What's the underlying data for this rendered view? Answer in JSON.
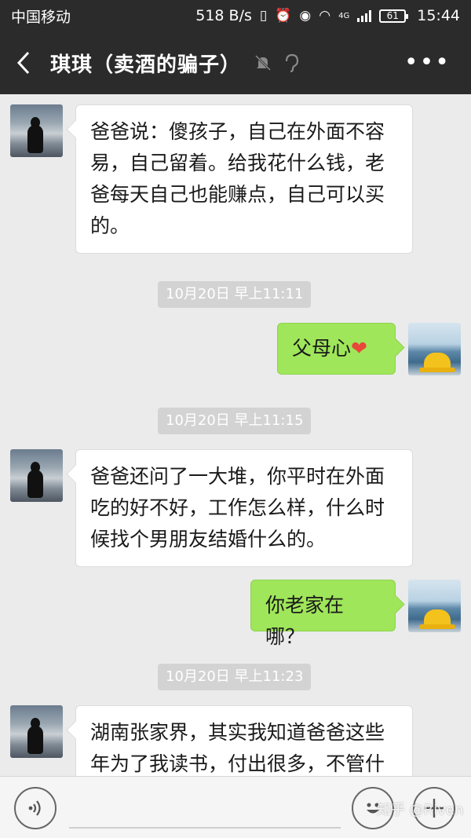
{
  "status_bar": {
    "carrier": "中国移动",
    "speed": "518 B/s",
    "network": "4G",
    "battery": "61",
    "time": "15:44"
  },
  "header": {
    "back_icon": "chevron-left-icon",
    "title": "琪琪（卖酒的骗子）",
    "mute_icon": "bell-muted-icon",
    "earpiece_icon": "ear-icon",
    "more_label": "•••"
  },
  "messages": [
    {
      "side": "left",
      "text": "爸爸说：傻孩子，自己在外面不容易，自己留着。给我花什么钱，老爸每天自己也能赚点，自己可以买的。"
    },
    {
      "type": "time",
      "text": "10月20日 早上11:11"
    },
    {
      "side": "right",
      "text": "父母心",
      "emoji": "❤"
    },
    {
      "type": "time",
      "text": "10月20日 早上11:15"
    },
    {
      "side": "left",
      "text": "爸爸还问了一大堆，你平时在外面吃的好不好，工作怎么样，什么时候找个男朋友结婚什么的。"
    },
    {
      "side": "right",
      "text": "你老家在哪？"
    },
    {
      "type": "time",
      "text": "10月20日 早上11:23"
    },
    {
      "side": "left",
      "text": "湖南张家界，其实我知道爸爸这些年为了我读书，付出很多，不管什"
    }
  ],
  "input_bar": {
    "voice_icon": "voice-icon",
    "emoji_icon": "emoji-icon",
    "plus_icon": "plus-icon"
  },
  "watermark": "知乎 @Riven"
}
